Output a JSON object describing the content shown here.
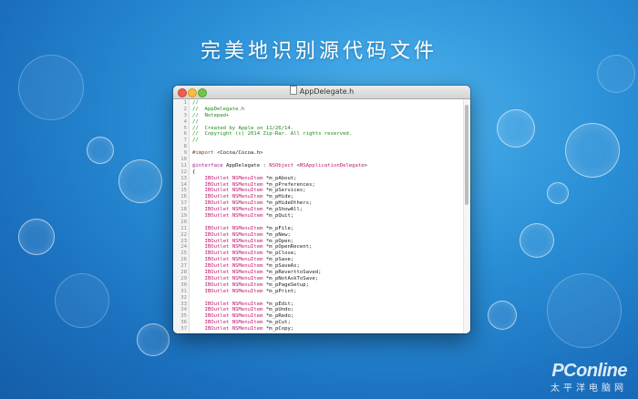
{
  "headline": "完美地识别源代码文件",
  "window": {
    "title": "AppDelegate.h",
    "file_icon": "document-icon"
  },
  "editor": {
    "lines": [
      {
        "n": "1",
        "parts": [
          {
            "t": "//",
            "c": "c"
          }
        ]
      },
      {
        "n": "2",
        "parts": [
          {
            "t": "//  AppDelegate.h",
            "c": "c"
          }
        ]
      },
      {
        "n": "3",
        "parts": [
          {
            "t": "//  Notepad+",
            "c": "c"
          }
        ]
      },
      {
        "n": "4",
        "parts": [
          {
            "t": "//",
            "c": "c"
          }
        ]
      },
      {
        "n": "5",
        "parts": [
          {
            "t": "//  Created by Apple on 11/26/14.",
            "c": "c"
          }
        ]
      },
      {
        "n": "6",
        "parts": [
          {
            "t": "//  Copyright (c) 2014 Zip-Rar. All rights reserved.",
            "c": "c"
          }
        ]
      },
      {
        "n": "7",
        "parts": [
          {
            "t": "//",
            "c": "c"
          }
        ]
      },
      {
        "n": "8",
        "parts": [
          {
            "t": "",
            "c": ""
          }
        ]
      },
      {
        "n": "9",
        "parts": [
          {
            "t": "#import",
            "c": "p"
          },
          {
            "t": " <Cocoa/Cocoa.h>",
            "c": ""
          }
        ]
      },
      {
        "n": "10",
        "parts": [
          {
            "t": "",
            "c": ""
          }
        ]
      },
      {
        "n": "11",
        "parts": [
          {
            "t": "@interface",
            "c": "k"
          },
          {
            "t": " AppDelegate : ",
            "c": ""
          },
          {
            "t": "NSObject",
            "c": "m"
          },
          {
            "t": " <",
            "c": ""
          },
          {
            "t": "NSApplicationDelegate",
            "c": "m"
          },
          {
            "t": ">",
            "c": ""
          }
        ]
      },
      {
        "n": "12",
        "parts": [
          {
            "t": "{",
            "c": ""
          }
        ]
      },
      {
        "n": "13",
        "parts": [
          {
            "t": "    ",
            "c": ""
          },
          {
            "t": "IBOutlet",
            "c": "m"
          },
          {
            "t": " ",
            "c": ""
          },
          {
            "t": "NSMenuItem",
            "c": "m"
          },
          {
            "t": " *m_pAbout;",
            "c": ""
          }
        ]
      },
      {
        "n": "14",
        "parts": [
          {
            "t": "    ",
            "c": ""
          },
          {
            "t": "IBOutlet",
            "c": "m"
          },
          {
            "t": " ",
            "c": ""
          },
          {
            "t": "NSMenuItem",
            "c": "m"
          },
          {
            "t": " *m_pPreferences;",
            "c": ""
          }
        ]
      },
      {
        "n": "15",
        "parts": [
          {
            "t": "    ",
            "c": ""
          },
          {
            "t": "IBOutlet",
            "c": "m"
          },
          {
            "t": " ",
            "c": ""
          },
          {
            "t": "NSMenuItem",
            "c": "m"
          },
          {
            "t": " *m_pServices;",
            "c": ""
          }
        ]
      },
      {
        "n": "16",
        "parts": [
          {
            "t": "    ",
            "c": ""
          },
          {
            "t": "IBOutlet",
            "c": "m"
          },
          {
            "t": " ",
            "c": ""
          },
          {
            "t": "NSMenuItem",
            "c": "m"
          },
          {
            "t": " *m_pHide;",
            "c": ""
          }
        ]
      },
      {
        "n": "17",
        "parts": [
          {
            "t": "    ",
            "c": ""
          },
          {
            "t": "IBOutlet",
            "c": "m"
          },
          {
            "t": " ",
            "c": ""
          },
          {
            "t": "NSMenuItem",
            "c": "m"
          },
          {
            "t": " *m_pHideOthers;",
            "c": ""
          }
        ]
      },
      {
        "n": "18",
        "parts": [
          {
            "t": "    ",
            "c": ""
          },
          {
            "t": "IBOutlet",
            "c": "m"
          },
          {
            "t": " ",
            "c": ""
          },
          {
            "t": "NSMenuItem",
            "c": "m"
          },
          {
            "t": " *m_pShowAll;",
            "c": ""
          }
        ]
      },
      {
        "n": "19",
        "parts": [
          {
            "t": "    ",
            "c": ""
          },
          {
            "t": "IBOutlet",
            "c": "m"
          },
          {
            "t": " ",
            "c": ""
          },
          {
            "t": "NSMenuItem",
            "c": "m"
          },
          {
            "t": " *m_pQuit;",
            "c": ""
          }
        ]
      },
      {
        "n": "20",
        "parts": [
          {
            "t": "",
            "c": ""
          }
        ]
      },
      {
        "n": "21",
        "parts": [
          {
            "t": "    ",
            "c": ""
          },
          {
            "t": "IBOutlet",
            "c": "m"
          },
          {
            "t": " ",
            "c": ""
          },
          {
            "t": "NSMenuItem",
            "c": "m"
          },
          {
            "t": " *m_pFile;",
            "c": ""
          }
        ]
      },
      {
        "n": "22",
        "parts": [
          {
            "t": "    ",
            "c": ""
          },
          {
            "t": "IBOutlet",
            "c": "m"
          },
          {
            "t": " ",
            "c": ""
          },
          {
            "t": "NSMenuItem",
            "c": "m"
          },
          {
            "t": " *m_pNew;",
            "c": ""
          }
        ]
      },
      {
        "n": "23",
        "parts": [
          {
            "t": "    ",
            "c": ""
          },
          {
            "t": "IBOutlet",
            "c": "m"
          },
          {
            "t": " ",
            "c": ""
          },
          {
            "t": "NSMenuItem",
            "c": "m"
          },
          {
            "t": " *m_pOpen;",
            "c": ""
          }
        ]
      },
      {
        "n": "24",
        "parts": [
          {
            "t": "    ",
            "c": ""
          },
          {
            "t": "IBOutlet",
            "c": "m"
          },
          {
            "t": " ",
            "c": ""
          },
          {
            "t": "NSMenuItem",
            "c": "m"
          },
          {
            "t": " *m_pOpenRecent;",
            "c": ""
          }
        ]
      },
      {
        "n": "25",
        "parts": [
          {
            "t": "    ",
            "c": ""
          },
          {
            "t": "IBOutlet",
            "c": "m"
          },
          {
            "t": " ",
            "c": ""
          },
          {
            "t": "NSMenuItem",
            "c": "m"
          },
          {
            "t": " *m_pClose;",
            "c": ""
          }
        ]
      },
      {
        "n": "26",
        "parts": [
          {
            "t": "    ",
            "c": ""
          },
          {
            "t": "IBOutlet",
            "c": "m"
          },
          {
            "t": " ",
            "c": ""
          },
          {
            "t": "NSMenuItem",
            "c": "m"
          },
          {
            "t": " *m_pSave;",
            "c": ""
          }
        ]
      },
      {
        "n": "27",
        "parts": [
          {
            "t": "    ",
            "c": ""
          },
          {
            "t": "IBOutlet",
            "c": "m"
          },
          {
            "t": " ",
            "c": ""
          },
          {
            "t": "NSMenuItem",
            "c": "m"
          },
          {
            "t": " *m_pSaveAs;",
            "c": ""
          }
        ]
      },
      {
        "n": "28",
        "parts": [
          {
            "t": "    ",
            "c": ""
          },
          {
            "t": "IBOutlet",
            "c": "m"
          },
          {
            "t": " ",
            "c": ""
          },
          {
            "t": "NSMenuItem",
            "c": "m"
          },
          {
            "t": " *m_pReverttoSaved;",
            "c": ""
          }
        ]
      },
      {
        "n": "29",
        "parts": [
          {
            "t": "    ",
            "c": ""
          },
          {
            "t": "IBOutlet",
            "c": "m"
          },
          {
            "t": " ",
            "c": ""
          },
          {
            "t": "NSMenuItem",
            "c": "m"
          },
          {
            "t": " *m_pNotAskToSave;",
            "c": ""
          }
        ]
      },
      {
        "n": "30",
        "parts": [
          {
            "t": "    ",
            "c": ""
          },
          {
            "t": "IBOutlet",
            "c": "m"
          },
          {
            "t": " ",
            "c": ""
          },
          {
            "t": "NSMenuItem",
            "c": "m"
          },
          {
            "t": " *m_pPageSetup;",
            "c": ""
          }
        ]
      },
      {
        "n": "31",
        "parts": [
          {
            "t": "    ",
            "c": ""
          },
          {
            "t": "IBOutlet",
            "c": "m"
          },
          {
            "t": " ",
            "c": ""
          },
          {
            "t": "NSMenuItem",
            "c": "m"
          },
          {
            "t": " *m_pPrint;",
            "c": ""
          }
        ]
      },
      {
        "n": "32",
        "parts": [
          {
            "t": "",
            "c": ""
          }
        ]
      },
      {
        "n": "33",
        "parts": [
          {
            "t": "    ",
            "c": ""
          },
          {
            "t": "IBOutlet",
            "c": "m"
          },
          {
            "t": " ",
            "c": ""
          },
          {
            "t": "NSMenuItem",
            "c": "m"
          },
          {
            "t": " *m_pEdit;",
            "c": ""
          }
        ]
      },
      {
        "n": "34",
        "parts": [
          {
            "t": "    ",
            "c": ""
          },
          {
            "t": "IBOutlet",
            "c": "m"
          },
          {
            "t": " ",
            "c": ""
          },
          {
            "t": "NSMenuItem",
            "c": "m"
          },
          {
            "t": " *m_pUndo;",
            "c": ""
          }
        ]
      },
      {
        "n": "35",
        "parts": [
          {
            "t": "    ",
            "c": ""
          },
          {
            "t": "IBOutlet",
            "c": "m"
          },
          {
            "t": " ",
            "c": ""
          },
          {
            "t": "NSMenuItem",
            "c": "m"
          },
          {
            "t": " *m_pRedo;",
            "c": ""
          }
        ]
      },
      {
        "n": "36",
        "parts": [
          {
            "t": "    ",
            "c": ""
          },
          {
            "t": "IBOutlet",
            "c": "m"
          },
          {
            "t": " ",
            "c": ""
          },
          {
            "t": "NSMenuItem",
            "c": "m"
          },
          {
            "t": " *m_pCut;",
            "c": ""
          }
        ]
      },
      {
        "n": "37",
        "parts": [
          {
            "t": "    ",
            "c": ""
          },
          {
            "t": "IBOutlet",
            "c": "m"
          },
          {
            "t": " ",
            "c": ""
          },
          {
            "t": "NSMenuItem",
            "c": "m"
          },
          {
            "t": " *m_pCopy;",
            "c": ""
          }
        ]
      }
    ]
  },
  "watermark": {
    "logo": "PConline",
    "sub": "太平洋电脑网"
  }
}
